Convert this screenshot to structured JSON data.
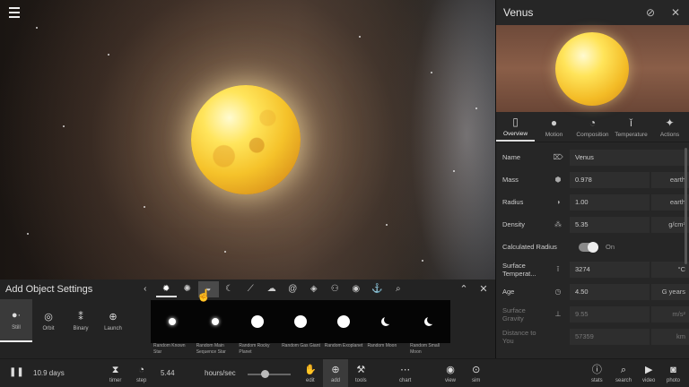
{
  "info_panel": {
    "title": "Venus",
    "header_icons": [
      "hide-orbit-icon",
      "close-icon"
    ],
    "tabs": [
      {
        "label": "Overview",
        "icon": "bookmark-icon",
        "active": true
      },
      {
        "label": "Motion",
        "icon": "motion-icon",
        "active": false
      },
      {
        "label": "Composition",
        "icon": "composition-icon",
        "active": false
      },
      {
        "label": "Temperature",
        "icon": "thermometer-icon",
        "active": false
      },
      {
        "label": "Actions",
        "icon": "actions-icon",
        "active": false
      }
    ],
    "properties": {
      "name": {
        "label": "Name",
        "value": "Venus"
      },
      "mass": {
        "label": "Mass",
        "value": "0.978",
        "unit": "earth"
      },
      "radius": {
        "label": "Radius",
        "value": "1.00",
        "unit": "earth"
      },
      "density": {
        "label": "Density",
        "value": "5.35",
        "unit": "g/cm³"
      },
      "calculated_radius": {
        "label": "Calculated Radius",
        "value": "On"
      },
      "surface_temperature": {
        "label": "Surface Temperat...",
        "value": "3274",
        "unit": "°C"
      },
      "age": {
        "label": "Age",
        "value": "4.50",
        "unit": "G years"
      },
      "surface_gravity": {
        "label": "Surface Gravity",
        "value": "9.55",
        "unit": "m/s²"
      },
      "distance": {
        "label": "Distance to You",
        "value": "57359",
        "unit": "km"
      }
    }
  },
  "add_panel": {
    "title": "Add Object Settings",
    "modes": [
      {
        "label": "Still",
        "icon": "still-icon",
        "active": true
      },
      {
        "label": "Orbit",
        "icon": "orbit-icon",
        "active": false
      },
      {
        "label": "Binary",
        "icon": "binary-icon",
        "active": false
      },
      {
        "label": "Launch",
        "icon": "launch-icon",
        "active": false
      }
    ],
    "objects": [
      {
        "label": "Random Known Star",
        "kind": "star"
      },
      {
        "label": "Random Main Sequence Star",
        "kind": "star"
      },
      {
        "label": "Random Rocky Planet",
        "kind": "ball"
      },
      {
        "label": "Random Gas Giant",
        "kind": "ball"
      },
      {
        "label": "Random Exoplanet",
        "kind": "ball"
      },
      {
        "label": "Random Moon",
        "kind": "moon"
      },
      {
        "label": "Random Small Moon",
        "kind": "moon"
      }
    ]
  },
  "bottom_bar": {
    "time": "10.9 days",
    "step_value": "5.44",
    "rate_unit": "hours/sec",
    "buttons": {
      "timer": "timer",
      "step": "step",
      "edit": "edit",
      "add": "add",
      "tools": "tools",
      "chart": "chart",
      "view": "view",
      "sim": "sim",
      "stats": "stats",
      "search": "search",
      "video": "video",
      "photo": "photo"
    }
  }
}
